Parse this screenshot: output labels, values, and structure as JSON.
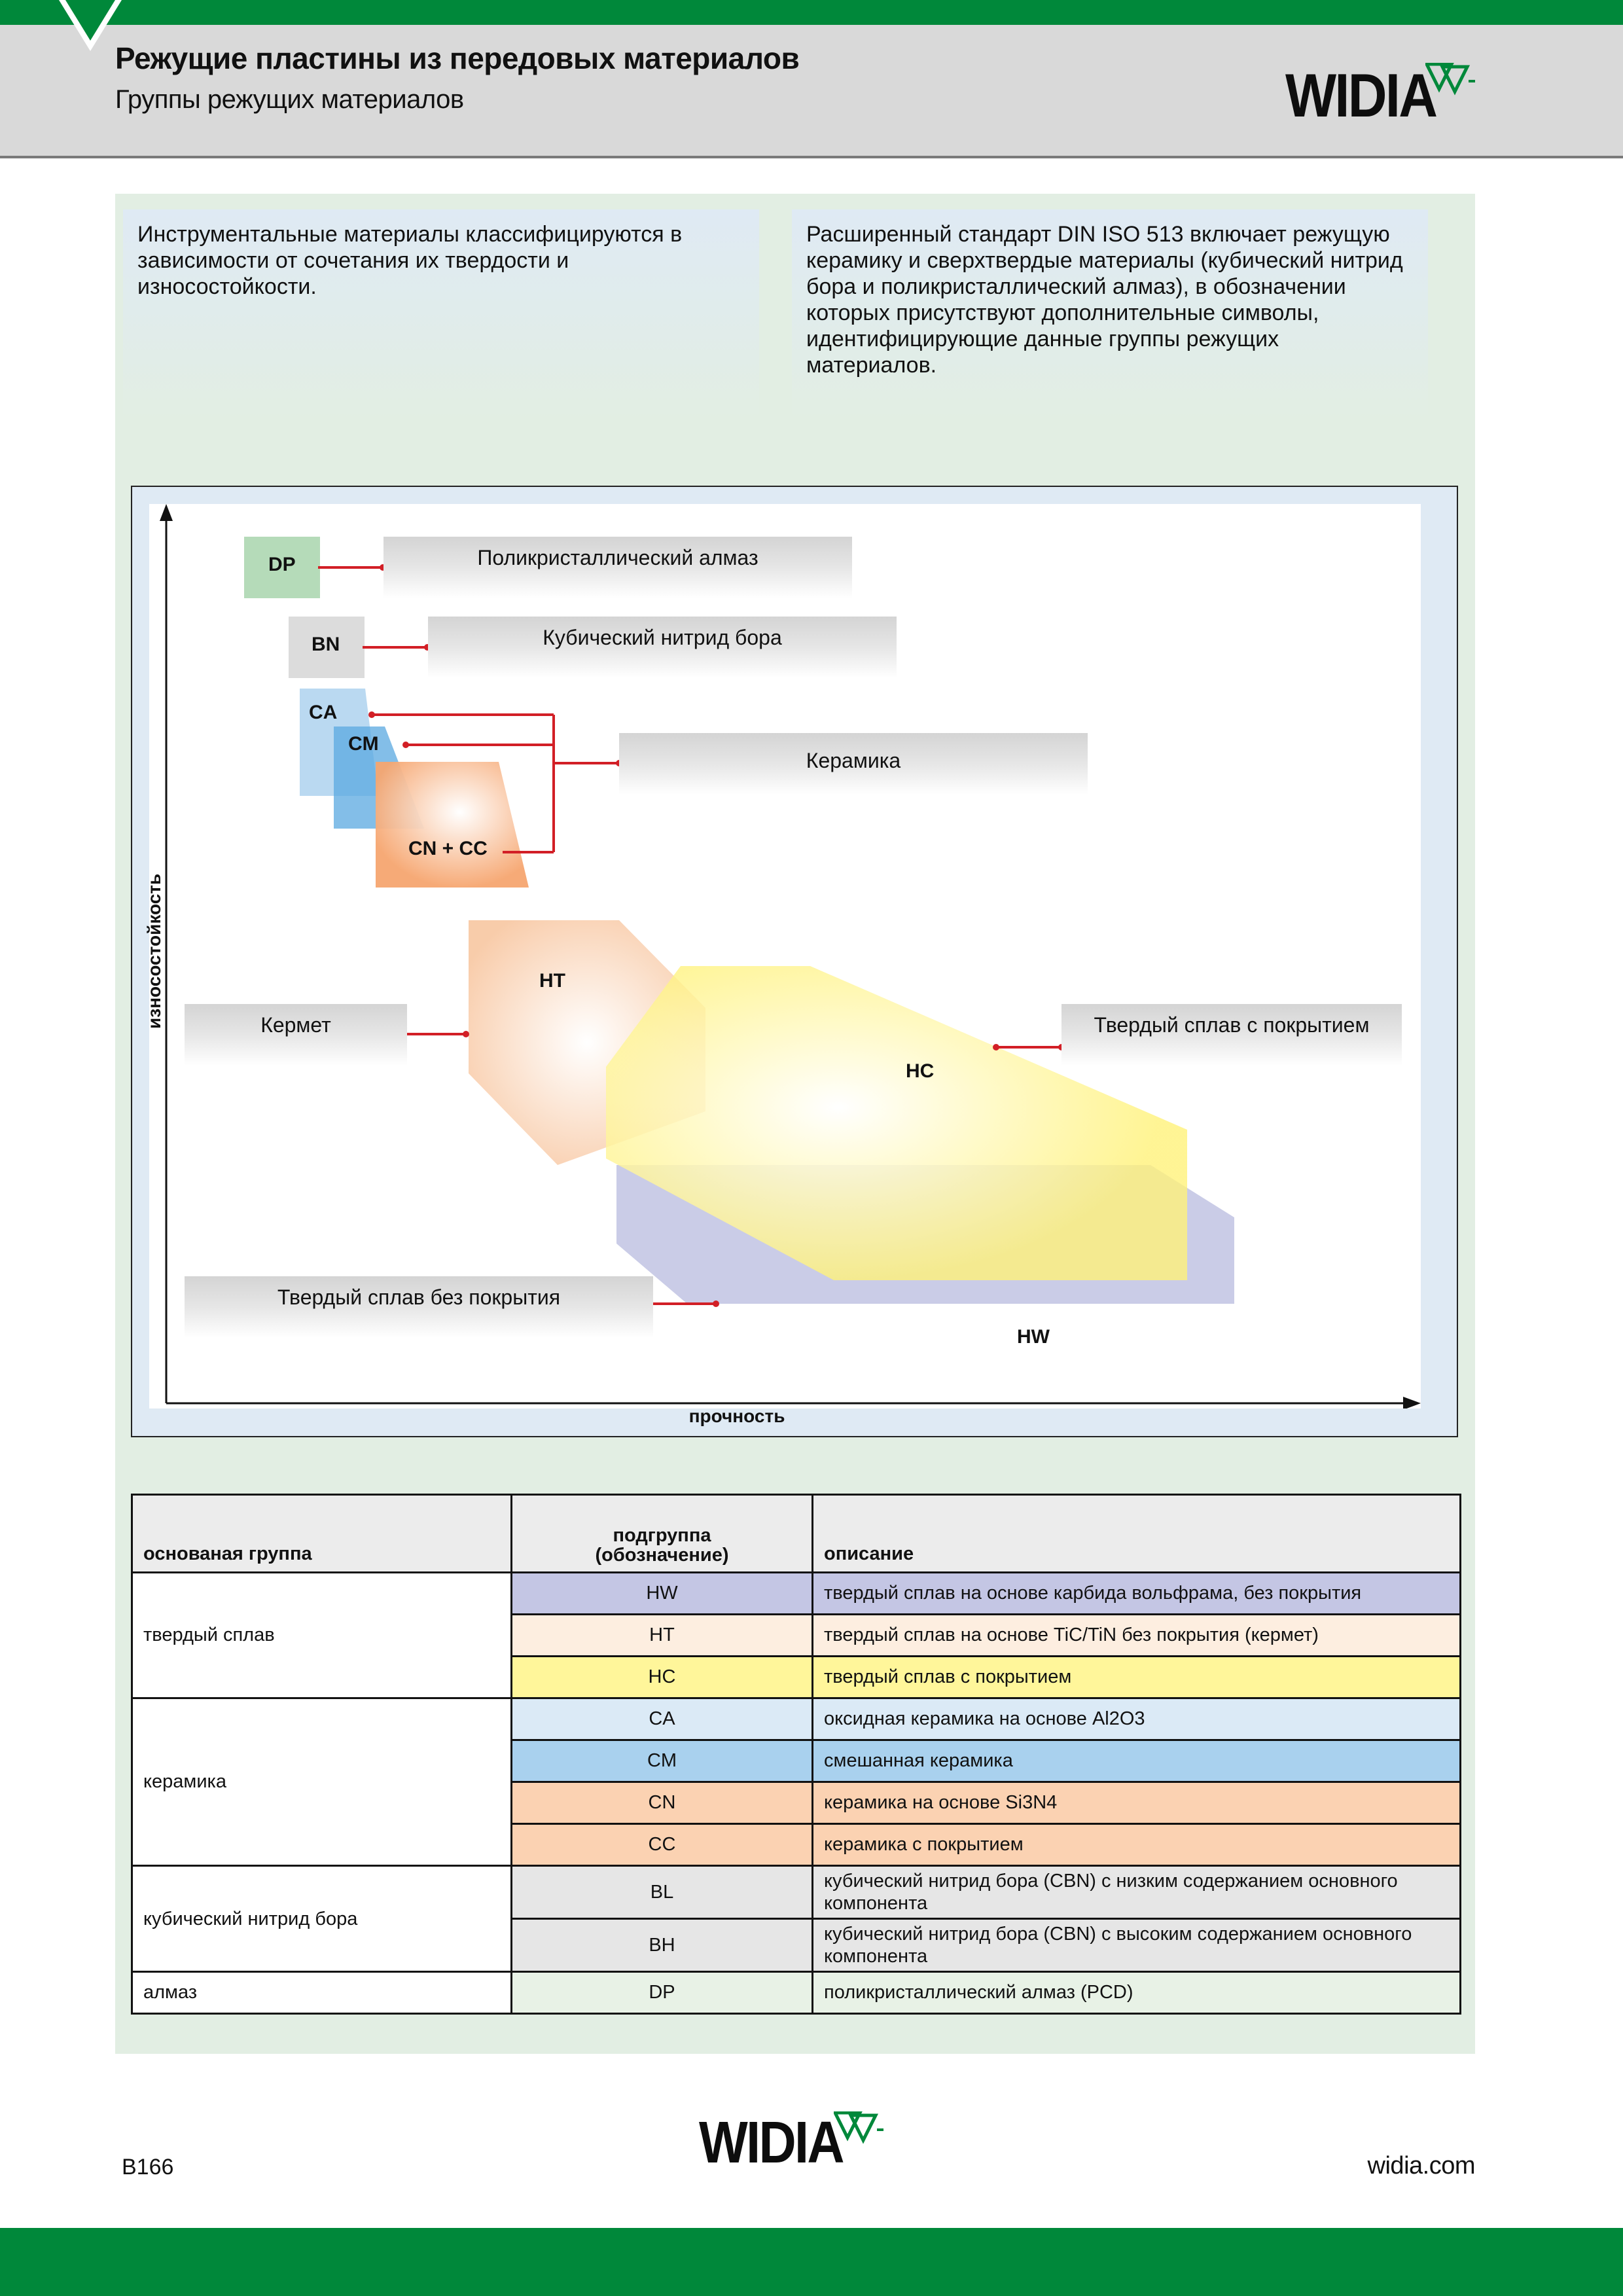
{
  "header": {
    "title": "Режущие пластины из передовых материалов",
    "subtitle": "Группы режущих материалов",
    "logo_text": "WIDIA"
  },
  "intro": {
    "left_text": "Инструментальные материалы классифицируются в зависимости от сочетания их твердости и износостойкости.",
    "right_text": "Расширенный стандарт DIN ISO 513 включает режущую керамику и сверхтвердые материалы (кубический нитрид бора и поликристаллический алмаз), в обозначении которых присутствуют дополнительные символы, идентифицирующие данные группы режущих материалов."
  },
  "diagram": {
    "y_axis_label": "износостойкость",
    "x_axis_label": "прочность",
    "tags": {
      "dp": "DP",
      "bn": "BN",
      "ca": "CA",
      "cm": "CM",
      "cn_cc": "CN + CC",
      "ht": "HT",
      "hc": "HC",
      "hw": "HW"
    },
    "labels": {
      "pcd": "Поликристаллический алмаз",
      "cbn": "Кубический нитрид бора",
      "ceramic": "Керамика",
      "cermet": "Кермет",
      "coated": "Твердый сплав с покрытием",
      "uncoated": "Твердый сплав без покрытия"
    },
    "colors": {
      "dp": "#b5dbb9",
      "bn": "#dcdcdc",
      "ca": "#aed2ef",
      "cm": "#6fb4e4",
      "cn": "#f6b27f",
      "ht": "#fbd2b2",
      "hc": "#fff27a",
      "hw": "#c4c6e4",
      "connector": "#d21f26"
    }
  },
  "table": {
    "headers": {
      "main_group": "основаная группа",
      "subgroup": "подгруппа\n(обозначение)",
      "description": "описание"
    },
    "groups": [
      {
        "name": "твердый сплав",
        "rows": [
          {
            "code": "HW",
            "desc": "твердый сплав на основе карбида вольфрама, без покрытия",
            "color": "#c4c6e4"
          },
          {
            "code": "HT",
            "desc": "твердый сплав на основе TiC/TiN без покрытия (кермет)",
            "color": "#fdeee0"
          },
          {
            "code": "HC",
            "desc": "твердый сплав с покрытием",
            "color": "#fff69a"
          }
        ]
      },
      {
        "name": "керамика",
        "rows": [
          {
            "code": "CA",
            "desc": "оксидная керамика на основе Al2O3",
            "color": "#dbeaf6"
          },
          {
            "code": "CM",
            "desc": "смешанная керамика",
            "color": "#a9d1ee"
          },
          {
            "code": "CN",
            "desc": "керамика на основе Si3N4",
            "color": "#fbd2b2"
          },
          {
            "code": "CC",
            "desc": "керамика с покрытием",
            "color": "#fbd2b2"
          }
        ]
      },
      {
        "name": "кубический нитрид бора",
        "rows": [
          {
            "code": "BL",
            "desc": "кубический нитрид бора (CBN) с низким содержанием основного компонента",
            "color": "#e6e6e6"
          },
          {
            "code": "BH",
            "desc": "кубический нитрид бора (CBN) с высоким содержанием основного компонента",
            "color": "#e6e6e6"
          }
        ]
      },
      {
        "name": "алмаз",
        "rows": [
          {
            "code": "DP",
            "desc": "поликристаллический алмаз (PCD)",
            "color": "#e8f2e6"
          }
        ]
      }
    ]
  },
  "footer": {
    "page_number": "B166",
    "site": "widia.com",
    "logo_text": "WIDIA"
  }
}
